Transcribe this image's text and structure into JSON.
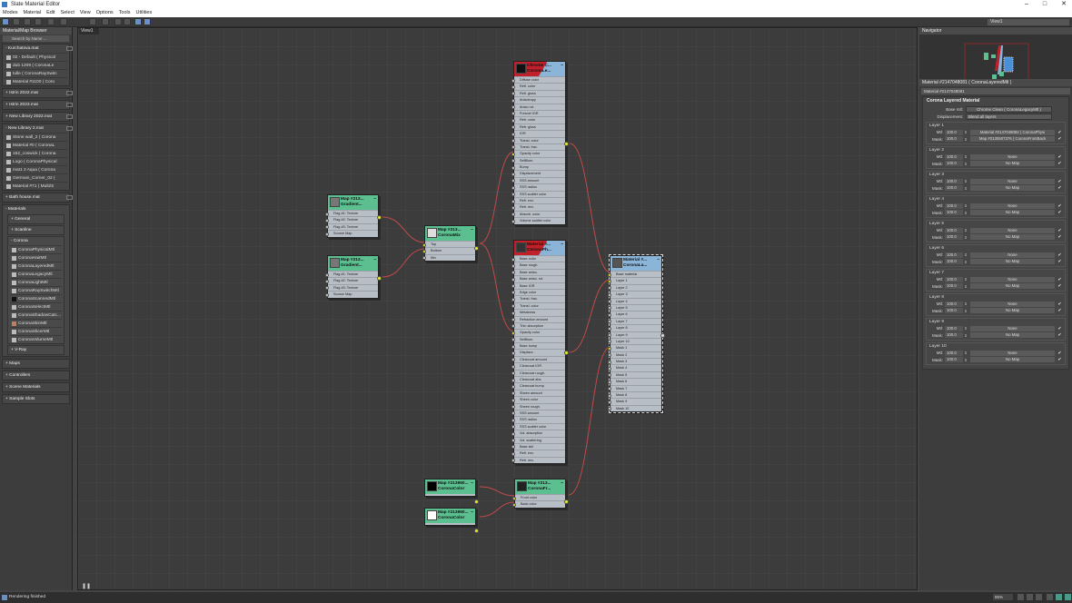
{
  "window": {
    "title": "Slate Material Editor",
    "controls": [
      "–",
      "□",
      "✕"
    ]
  },
  "menu": [
    "Modes",
    "Material",
    "Edit",
    "Select",
    "View",
    "Options",
    "Tools",
    "Utilities"
  ],
  "view_selector": "View1",
  "view_tab": "View1",
  "browser": {
    "title": "Material/Map Browser",
    "search_placeholder": "Search by Name ...",
    "libraries": [
      {
        "name": "- Kurchatova.mat",
        "items": [
          "02 - Default  ( Physical",
          "dub 1209  ( CoronaLe",
          "tulle  ( CoronaRaySwitc",
          "Material #1100  ( Coro"
        ]
      },
      {
        "name": "+ Istrin 2022.mat",
        "items": []
      },
      {
        "name": "+ Istrin 2023.mat",
        "items": []
      },
      {
        "name": "+ New Library 2022.mat",
        "items": []
      },
      {
        "name": "- New Library 2.mat",
        "items": [
          "Stone wall_2  ( Corona",
          "Material #0  ( CoronaL",
          "152_coswick  ( Corona",
          "Logo  ( CoronaPhysical",
          "mat1 2 Aqua  ( Corona",
          "Germain_Corner_02  (",
          "Material #71  ( Multi/S"
        ]
      },
      {
        "name": "+ Bath house.mat",
        "items": []
      }
    ],
    "materials": {
      "title": "- Materials",
      "groups": [
        "+ General",
        "+ Scanline"
      ],
      "corona_title": "- Corona",
      "corona": [
        "CoronaPhysicalMtl",
        "CoronaHairMtl",
        "CoronaLayeredMtl",
        "CoronaLegacyMtl",
        "CoronaLightMtl",
        "CoronaRaySwitchMtl",
        "CoronaScannedMtl",
        "CoronaSelectMtl",
        "CoronaShadowCatc...",
        "CoronaSkinMtl",
        "CoronaSlicerMtl",
        "CoronaVolumeMtl"
      ],
      "vray": "+ V-Ray"
    },
    "other": [
      "+ Maps",
      "+ Controllers",
      "+ Scene Materials",
      "+ Sample Slots"
    ]
  },
  "nodes": {
    "chrome": {
      "t1": "Chrome C...",
      "t2": "CoronaLe...",
      "rows": [
        "Diffuse color",
        "Refl. color",
        "Refl. gloss",
        "Anisotropy",
        "Aniso rot.",
        "Fresnel IOR",
        "Refr. color",
        "Refr. gloss",
        "IOR",
        "Transl. color",
        "Transl. frac.",
        "Opacity color",
        "Selfillum.",
        "Bump",
        "Displacement",
        "SSS amount",
        "SSS radius",
        "SSS scatter color",
        "Refl. env.",
        "Refr. env.",
        "Absorb. color",
        "Volume scatter color"
      ]
    },
    "physical": {
      "t1": "Material #...",
      "t2": "CoronaPh...",
      "rows": [
        "Base color",
        "Base rough.",
        "Base aniso.",
        "Base aniso. rot.",
        "Base IOR",
        "Edge color",
        "Transl. frac.",
        "Transl. color",
        "Metalness",
        "Refraction amount",
        "Thin absorption",
        "Opacity color",
        "Selfillum.",
        "Base bump",
        "Displace.",
        "Clearcoat amount",
        "Clearcoat IOR",
        "Clearcoat rough.",
        "Clearcoat abs.",
        "Clearcoat bump",
        "Sheen amount",
        "Sheen color",
        "Sheen rough.",
        "SSS amount",
        "SSS radius",
        "SSS scatter color",
        "Vol. absorption",
        "Vol. scattering",
        "Base tail",
        "Refl. env.",
        "Refr. env."
      ]
    },
    "layered": {
      "t1": "Material #...",
      "t2": "CoronaLa...",
      "rows": [
        "Base material",
        "Layer 1",
        "Layer 2",
        "Layer 3",
        "Layer 4",
        "Layer 5",
        "Layer 6",
        "Layer 7",
        "Layer 8",
        "Layer 9",
        "Layer 10",
        "Mask 1",
        "Mask 2",
        "Mask 3",
        "Mask 4",
        "Mask 5",
        "Mask 6",
        "Mask 7",
        "Mask 8",
        "Mask 9",
        "Mask 10"
      ]
    },
    "gradient1": {
      "t1": "Map #213...",
      "t2": "Gradient...",
      "rows": [
        "Flag #1: Texture",
        "Flag #2: Texture",
        "Flag #3: Texture",
        "Source Map"
      ]
    },
    "gradient2": {
      "t1": "Map #213...",
      "t2": "Gradient...",
      "rows": [
        "Flag #1: Texture",
        "Flag #2: Texture",
        "Flag #3: Texture",
        "Source Map"
      ]
    },
    "mix": {
      "t1": "Map #213...",
      "t2": "CoronaMix",
      "rows": [
        "Top",
        "Bottom",
        "Mix"
      ]
    },
    "color_black": {
      "t1": "Map #213950...",
      "t2": "CoronaColor",
      "rows": []
    },
    "color_white": {
      "t1": "Map #213950...",
      "t2": "CoronaColor",
      "rows": []
    },
    "front": {
      "t1": "Map #213...",
      "t2": "CoronaFr...",
      "rows": [
        "Front color",
        "Back color"
      ]
    }
  },
  "navigator": {
    "title": "Navigator"
  },
  "properties": {
    "title": "Material #2147048081  ( CoronaLayeredMtl )",
    "name_field": "Material #2147048081",
    "rollout": "Corona Layered Material",
    "base_mtl_label": "Base mtl:",
    "base_mtl": "Chrome Clean  ( CoronaLegacyMtl )",
    "displacement_label": "Displacement:",
    "displacement": "Blend all layers",
    "mtl_label": "Mtl:",
    "mask_label": "Mask:",
    "layers": [
      {
        "title": "Layer 1",
        "mtl_amt": "100.0",
        "mtl": "Material #2147048082  ( CoronaPhysi",
        "mask_amt": "100.0",
        "mask": "Map #2135507376  ( CoronaFrontBack"
      },
      {
        "title": "Layer 2",
        "mtl_amt": "100.0",
        "mtl": "None",
        "mask_amt": "100.0",
        "mask": "No Map"
      },
      {
        "title": "Layer 3",
        "mtl_amt": "100.0",
        "mtl": "None",
        "mask_amt": "100.0",
        "mask": "No Map"
      },
      {
        "title": "Layer 4",
        "mtl_amt": "100.0",
        "mtl": "None",
        "mask_amt": "100.0",
        "mask": "No Map"
      },
      {
        "title": "Layer 5",
        "mtl_amt": "100.0",
        "mtl": "None",
        "mask_amt": "100.0",
        "mask": "No Map"
      },
      {
        "title": "Layer 6",
        "mtl_amt": "100.0",
        "mtl": "None",
        "mask_amt": "100.0",
        "mask": "No Map"
      },
      {
        "title": "Layer 7",
        "mtl_amt": "100.0",
        "mtl": "None",
        "mask_amt": "100.0",
        "mask": "No Map"
      },
      {
        "title": "Layer 8",
        "mtl_amt": "100.0",
        "mtl": "None",
        "mask_amt": "100.0",
        "mask": "No Map"
      },
      {
        "title": "Layer 9",
        "mtl_amt": "100.0",
        "mtl": "None",
        "mask_amt": "100.0",
        "mask": "No Map"
      },
      {
        "title": "Layer 10",
        "mtl_amt": "100.0",
        "mtl": "None",
        "mask_amt": "100.0",
        "mask": "No Map"
      }
    ]
  },
  "status": {
    "text": "Rendering finished",
    "zoom": "85%"
  },
  "colors": {
    "wire": "#c04a4a",
    "map_node": "#5cbf90",
    "material_node": "#8ab4d8",
    "port_active": "#e8f020"
  }
}
